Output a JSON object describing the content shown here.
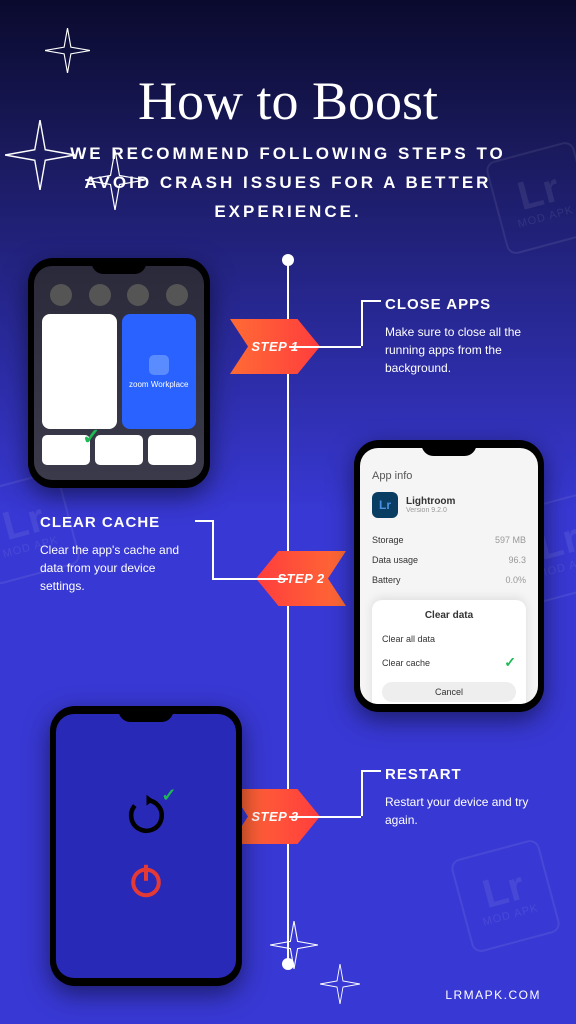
{
  "title": "How to Boost",
  "subtitle": "WE RECOMMEND FOLLOWING STEPS TO AVOID CRASH ISSUES FOR A BETTER EXPERIENCE.",
  "steps": [
    {
      "badge": "STEP 1",
      "heading": "CLOSE APPS",
      "body": "Make sure to close all the running apps from the background."
    },
    {
      "badge": "STEP 2",
      "heading": "CLEAR CACHE",
      "body": "Clear the app's cache and data from your device settings."
    },
    {
      "badge": "STEP 3",
      "heading": "RESTART",
      "body": "Restart your device and try again."
    }
  ],
  "phone1": {
    "zoom_label": "zoom Workplace"
  },
  "phone2": {
    "screen_title": "App info",
    "app_name": "Lightroom",
    "app_version": "Version 9.2.0",
    "storage_label": "Storage",
    "storage_value": "597 MB",
    "data_label": "Data usage",
    "data_value": "96.3",
    "battery_label": "Battery",
    "battery_value": "0.0%",
    "modal_title": "Clear data",
    "opt1": "Clear all data",
    "opt2": "Clear cache",
    "cancel": "Cancel"
  },
  "watermark": {
    "lr": "Lr",
    "text": "MOD APK"
  },
  "footer": "LRMAPK.COM"
}
